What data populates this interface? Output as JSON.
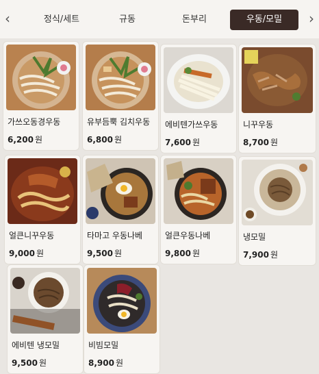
{
  "nav": {
    "prev_icon": "chevron-left-icon",
    "next_icon": "chevron-right-icon",
    "tabs": [
      {
        "label": "정식/세트",
        "active": false
      },
      {
        "label": "규동",
        "active": false
      },
      {
        "label": "돈부리",
        "active": false
      },
      {
        "label": "우동/모밀",
        "active": true
      }
    ]
  },
  "currency": "원",
  "menu": [
    {
      "name": "가쓰오동경우동",
      "price": "6,200"
    },
    {
      "name": "유부듬뿍 김치우동",
      "price": "6,800"
    },
    {
      "name": "에비텐가쓰우동",
      "price": "7,600"
    },
    {
      "name": "니꾸우동",
      "price": "8,700"
    },
    {
      "name": "얼큰니꾸우동",
      "price": "9,000"
    },
    {
      "name": "타마고 우동나베",
      "price": "9,500"
    },
    {
      "name": "얼큰우동나베",
      "price": "9,800"
    },
    {
      "name": "냉모밀",
      "price": "7,900"
    },
    {
      "name": "에비텐 냉모밀",
      "price": "9,500"
    },
    {
      "name": "비빔모밀",
      "price": "8,900"
    }
  ],
  "colors": {
    "active_tab": "#3a2a26",
    "background": "#e9e6e2",
    "card": "#f7f5f2"
  }
}
